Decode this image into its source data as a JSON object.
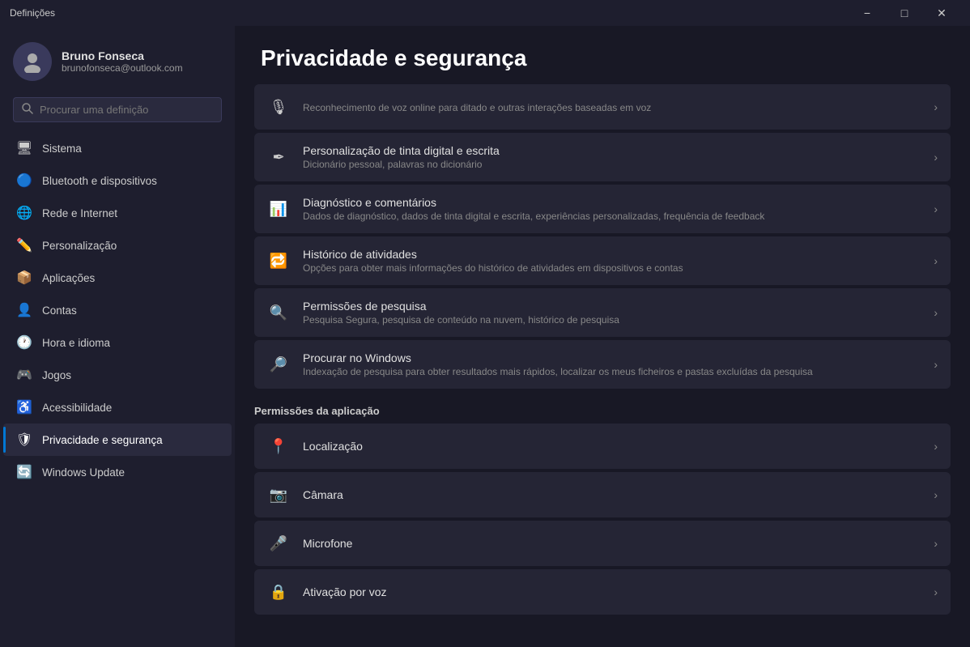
{
  "titlebar": {
    "title": "Definições",
    "minimize_label": "−",
    "maximize_label": "□",
    "close_label": "✕"
  },
  "sidebar": {
    "back_label": "←",
    "search_placeholder": "Procurar uma definição",
    "user": {
      "name": "Bruno Fonseca",
      "email": "brunofonseca@outlook.com"
    },
    "nav_items": [
      {
        "id": "sistema",
        "label": "Sistema",
        "icon": "🖥"
      },
      {
        "id": "bluetooth",
        "label": "Bluetooth e dispositivos",
        "icon": "🔵"
      },
      {
        "id": "rede",
        "label": "Rede e Internet",
        "icon": "🌐"
      },
      {
        "id": "personalizacao",
        "label": "Personalização",
        "icon": "✏️"
      },
      {
        "id": "aplicacoes",
        "label": "Aplicações",
        "icon": "📦"
      },
      {
        "id": "contas",
        "label": "Contas",
        "icon": "👤"
      },
      {
        "id": "hora",
        "label": "Hora e idioma",
        "icon": "🕐"
      },
      {
        "id": "jogos",
        "label": "Jogos",
        "icon": "🎮"
      },
      {
        "id": "acessibilidade",
        "label": "Acessibilidade",
        "icon": "♿"
      },
      {
        "id": "privacidade",
        "label": "Privacidade e segurança",
        "icon": "🛡",
        "active": true
      },
      {
        "id": "windows-update",
        "label": "Windows Update",
        "icon": "🔄"
      }
    ]
  },
  "content": {
    "page_title": "Privacidade e segurança",
    "items": [
      {
        "id": "reconhecimento-voz",
        "icon": "🎙",
        "title": "",
        "desc": "Reconhecimento de voz online para ditado e outras interações baseadas em voz"
      },
      {
        "id": "tinta-digital",
        "icon": "✒",
        "title": "Personalização de tinta digital e escrita",
        "desc": "Dicionário pessoal, palavras no dicionário"
      },
      {
        "id": "diagnostico",
        "icon": "📊",
        "title": "Diagnóstico e comentários",
        "desc": "Dados de diagnóstico, dados de tinta digital e escrita, experiências personalizadas, frequência de feedback"
      },
      {
        "id": "historico",
        "icon": "🔁",
        "title": "Histórico de atividades",
        "desc": "Opções para obter mais informações do histórico de atividades em dispositivos e contas"
      },
      {
        "id": "permissoes-pesquisa",
        "icon": "🔍",
        "title": "Permissões de pesquisa",
        "desc": "Pesquisa Segura, pesquisa de conteúdo na nuvem, histórico de pesquisa"
      },
      {
        "id": "procurar-windows",
        "icon": "🔎",
        "title": "Procurar no Windows",
        "desc": "Indexação de pesquisa para obter resultados mais rápidos, localizar os meus ficheiros e pastas excluídas da pesquisa"
      }
    ],
    "app_permissions_header": "Permissões da aplicação",
    "app_permissions": [
      {
        "id": "localizacao",
        "icon": "📍",
        "title": "Localização",
        "desc": ""
      },
      {
        "id": "camara",
        "icon": "📷",
        "title": "Câmara",
        "desc": ""
      },
      {
        "id": "microfone",
        "icon": "🎤",
        "title": "Microfone",
        "desc": ""
      },
      {
        "id": "ativacao-voz",
        "icon": "🔒",
        "title": "Ativação por voz",
        "desc": ""
      }
    ]
  }
}
